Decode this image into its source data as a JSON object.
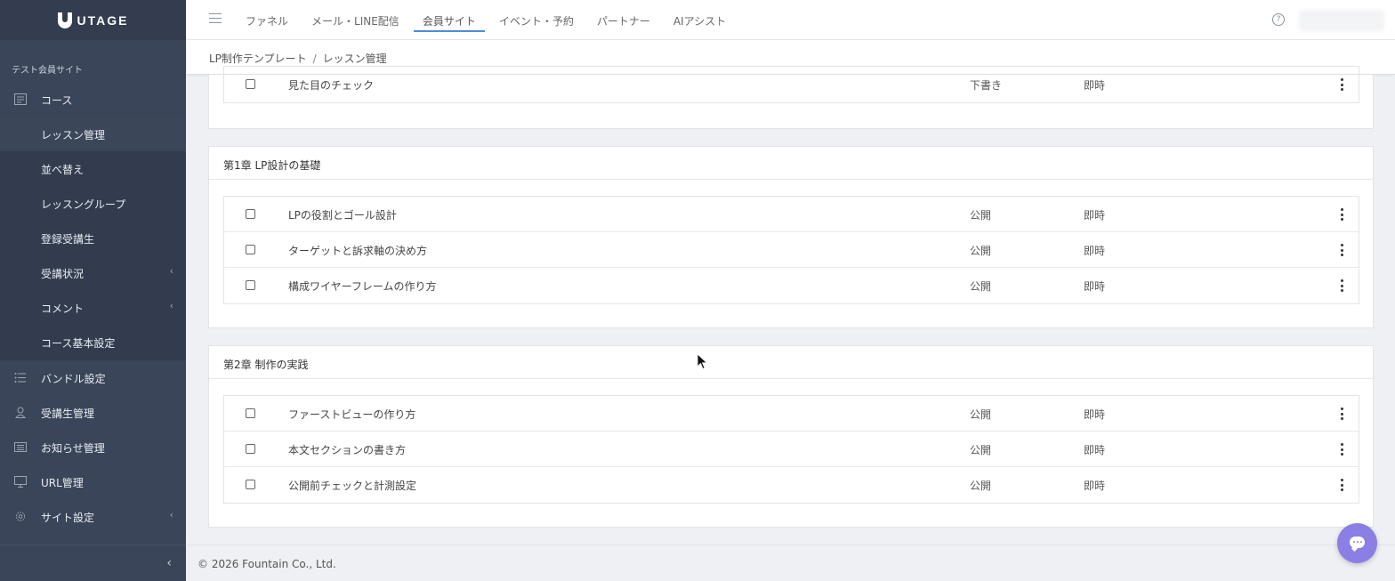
{
  "brand": {
    "name": "UTAGE"
  },
  "sidebar": {
    "site_name": "テスト会員サイト",
    "items": [
      {
        "label": "コース",
        "icon": "document-icon"
      },
      {
        "label": "レッスン管理"
      },
      {
        "label": "並べ替え"
      },
      {
        "label": "レッスングループ"
      },
      {
        "label": "登録受講生"
      },
      {
        "label": "受講状況",
        "chevron": "‹"
      },
      {
        "label": "コメント",
        "chevron": "‹"
      },
      {
        "label": "コース基本設定"
      },
      {
        "label": "バンドル設定",
        "icon": "list-icon"
      },
      {
        "label": "受講生管理",
        "icon": "person-icon"
      },
      {
        "label": "お知らせ管理",
        "icon": "newspaper-icon"
      },
      {
        "label": "URL管理",
        "icon": "monitor-icon"
      },
      {
        "label": "サイト設定",
        "icon": "gear-icon",
        "chevron": "‹"
      }
    ],
    "collapse_glyph": "‹"
  },
  "topnav": {
    "items": [
      "ファネル",
      "メール・LINE配信",
      "会員サイト",
      "イベント・予約",
      "パートナー",
      "AIアシスト"
    ],
    "active": "会員サイト",
    "help_glyph": "?"
  },
  "breadcrumb": {
    "parent": "LP制作テンプレート",
    "separator": "/",
    "current": "レッスン管理"
  },
  "sections": [
    {
      "title": "",
      "rows": [
        {
          "title": "見た目のチェック",
          "status": "下書き",
          "timing": "即時"
        }
      ]
    },
    {
      "title": "第1章 LP設計の基礎",
      "rows": [
        {
          "title": "LPの役割とゴール設計",
          "status": "公開",
          "timing": "即時"
        },
        {
          "title": "ターゲットと訴求軸の決め方",
          "status": "公開",
          "timing": "即時"
        },
        {
          "title": "構成ワイヤーフレームの作り方",
          "status": "公開",
          "timing": "即時"
        }
      ]
    },
    {
      "title": "第2章 制作の実践",
      "rows": [
        {
          "title": "ファーストビューの作り方",
          "status": "公開",
          "timing": "即時"
        },
        {
          "title": "本文セクションの書き方",
          "status": "公開",
          "timing": "即時"
        },
        {
          "title": "公開前チェックと計測設定",
          "status": "公開",
          "timing": "即時"
        }
      ]
    }
  ],
  "footer": {
    "copyright": "© 2026 Fountain Co., Ltd."
  },
  "colors": {
    "sidebar": "#3a4559",
    "accent": "#4a8fd9",
    "chat": "#8b7fe6"
  }
}
